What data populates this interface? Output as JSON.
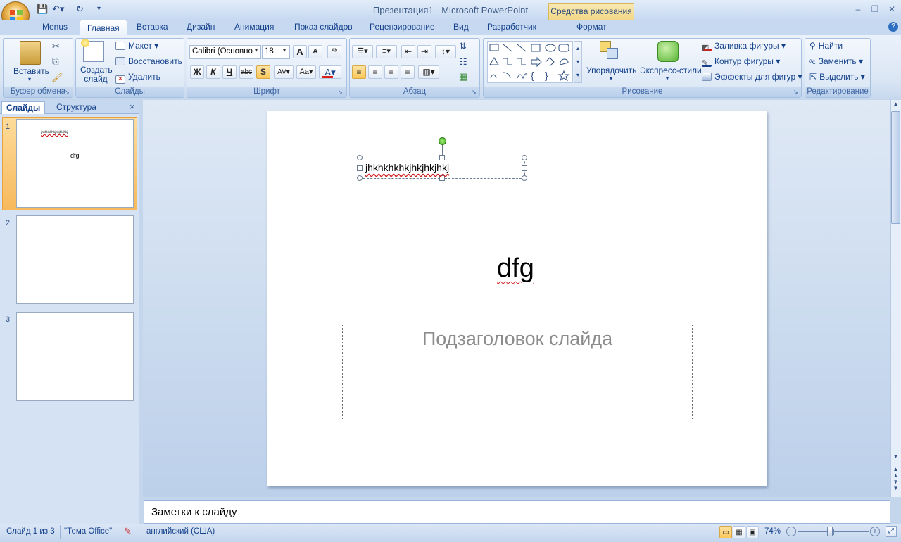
{
  "window": {
    "title": "Презентация1 - Microsoft PowerPoint",
    "contextual_tab": "Средства рисования"
  },
  "tabs": [
    "Menus",
    "Главная",
    "Вставка",
    "Дизайн",
    "Анимация",
    "Показ слайдов",
    "Рецензирование",
    "Вид",
    "Разработчик",
    "Формат"
  ],
  "active_tab": "Главная",
  "ribbon": {
    "clipboard": {
      "label": "Буфер обмена",
      "paste": "Вставить"
    },
    "slides": {
      "label": "Слайды",
      "new_slide": "Создать слайд",
      "layout": "Макет",
      "reset": "Восстановить",
      "delete": "Удалить"
    },
    "font": {
      "label": "Шрифт",
      "font_name": "Calibri (Основно",
      "font_size": "18",
      "bold": "Ж",
      "italic": "К",
      "underline": "Ч",
      "strike": "abc",
      "shadow": "S",
      "spacing": "AV",
      "case": "Aa",
      "color": "A",
      "grow": "A",
      "shrink": "A"
    },
    "paragraph": {
      "label": "Абзац"
    },
    "drawing": {
      "label": "Рисование",
      "arrange": "Упорядочить",
      "quick_styles": "Экспресс-стили",
      "fill": "Заливка фигуры",
      "outline": "Контур фигуры",
      "effects": "Эффекты для фигур"
    },
    "editing": {
      "label": "Редактирование",
      "find": "Найти",
      "replace": "Заменить",
      "select": "Выделить"
    }
  },
  "left_pane": {
    "tabs": [
      "Слайды",
      "Структура"
    ],
    "close": "×",
    "slides": [
      {
        "num": "1",
        "title": "dfg",
        "text": "jhkhkhkhkjhkjhkjhkj"
      },
      {
        "num": "2"
      },
      {
        "num": "3"
      }
    ]
  },
  "slide": {
    "textbox": "jhkhkhkhkjhkjhkjhkj",
    "title": "dfg",
    "subtitle_placeholder": "Подзаголовок слайда"
  },
  "notes_placeholder": "Заметки к слайду",
  "status": {
    "slide_info": "Слайд 1 из 3",
    "theme": "\"Тема Office\"",
    "language": "английский (США)",
    "zoom": "74%",
    "zoom_level": 0.45
  },
  "colors": {
    "accent": "#fbc75a",
    "ribbon_text": "#15428b",
    "font_color_bar": "#d8201d"
  }
}
